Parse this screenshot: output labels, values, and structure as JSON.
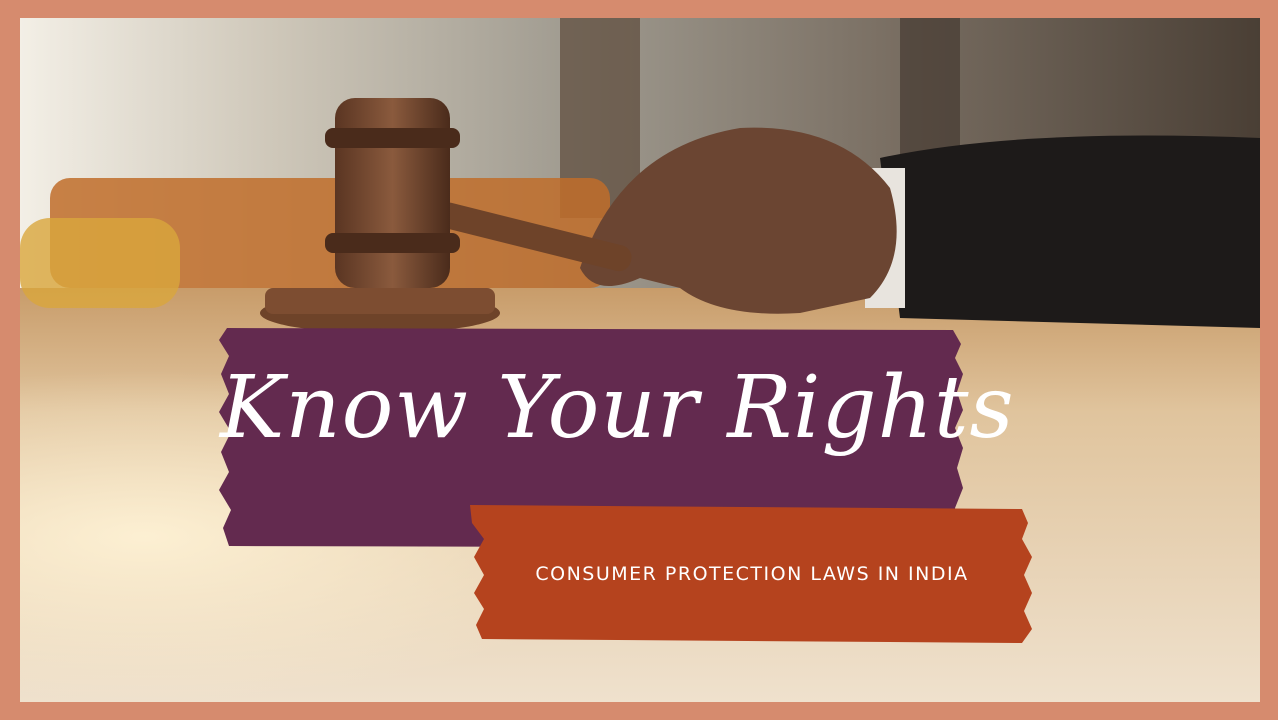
{
  "colors": {
    "border": "#d68b6e",
    "banner_purple": "#632a4f",
    "banner_orange": "#b5431e",
    "text": "#ffffff"
  },
  "hero": {
    "headline": "Know Your Rights",
    "subheadline": "CONSUMER PROTECTION LAWS IN INDIA"
  },
  "image": {
    "icon": "gavel-in-hand-photo"
  }
}
